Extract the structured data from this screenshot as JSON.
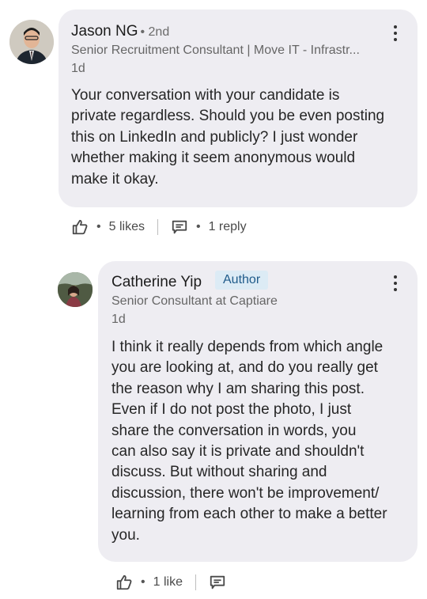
{
  "comment1": {
    "author": "Jason NG",
    "degree": "• 2nd",
    "headline": "Senior Recruitment Consultant | Move IT - Infrastr...",
    "time": "1d",
    "lines": [
      "Your conversation with your candidate is",
      "private regardless. Should you be even posting",
      "this on LinkedIn and publicly? I just wonder",
      "whether making it seem anonymous would",
      "make it okay."
    ],
    "likes": "5 likes",
    "replies": "1 reply"
  },
  "comment2": {
    "author": "Catherine Yip",
    "badge": "Author",
    "headline": "Senior Consultant at Captiare",
    "time": "1d",
    "lines": [
      "I think it really depends from which angle",
      "you are looking at, and do you really get",
      "the reason why I am sharing this post.",
      "Even if I do not post the photo, I just",
      "share the conversation in words, you",
      "can also say it is private and shouldn't",
      "discuss. But without sharing and",
      "discussion, there won't be improvement/",
      "learning from each other to make a better",
      "you."
    ],
    "likes": "1 like"
  },
  "icons": {
    "like": "like-thumb-icon",
    "reply": "reply-comment-icon",
    "more": "more-vertical-icon"
  }
}
